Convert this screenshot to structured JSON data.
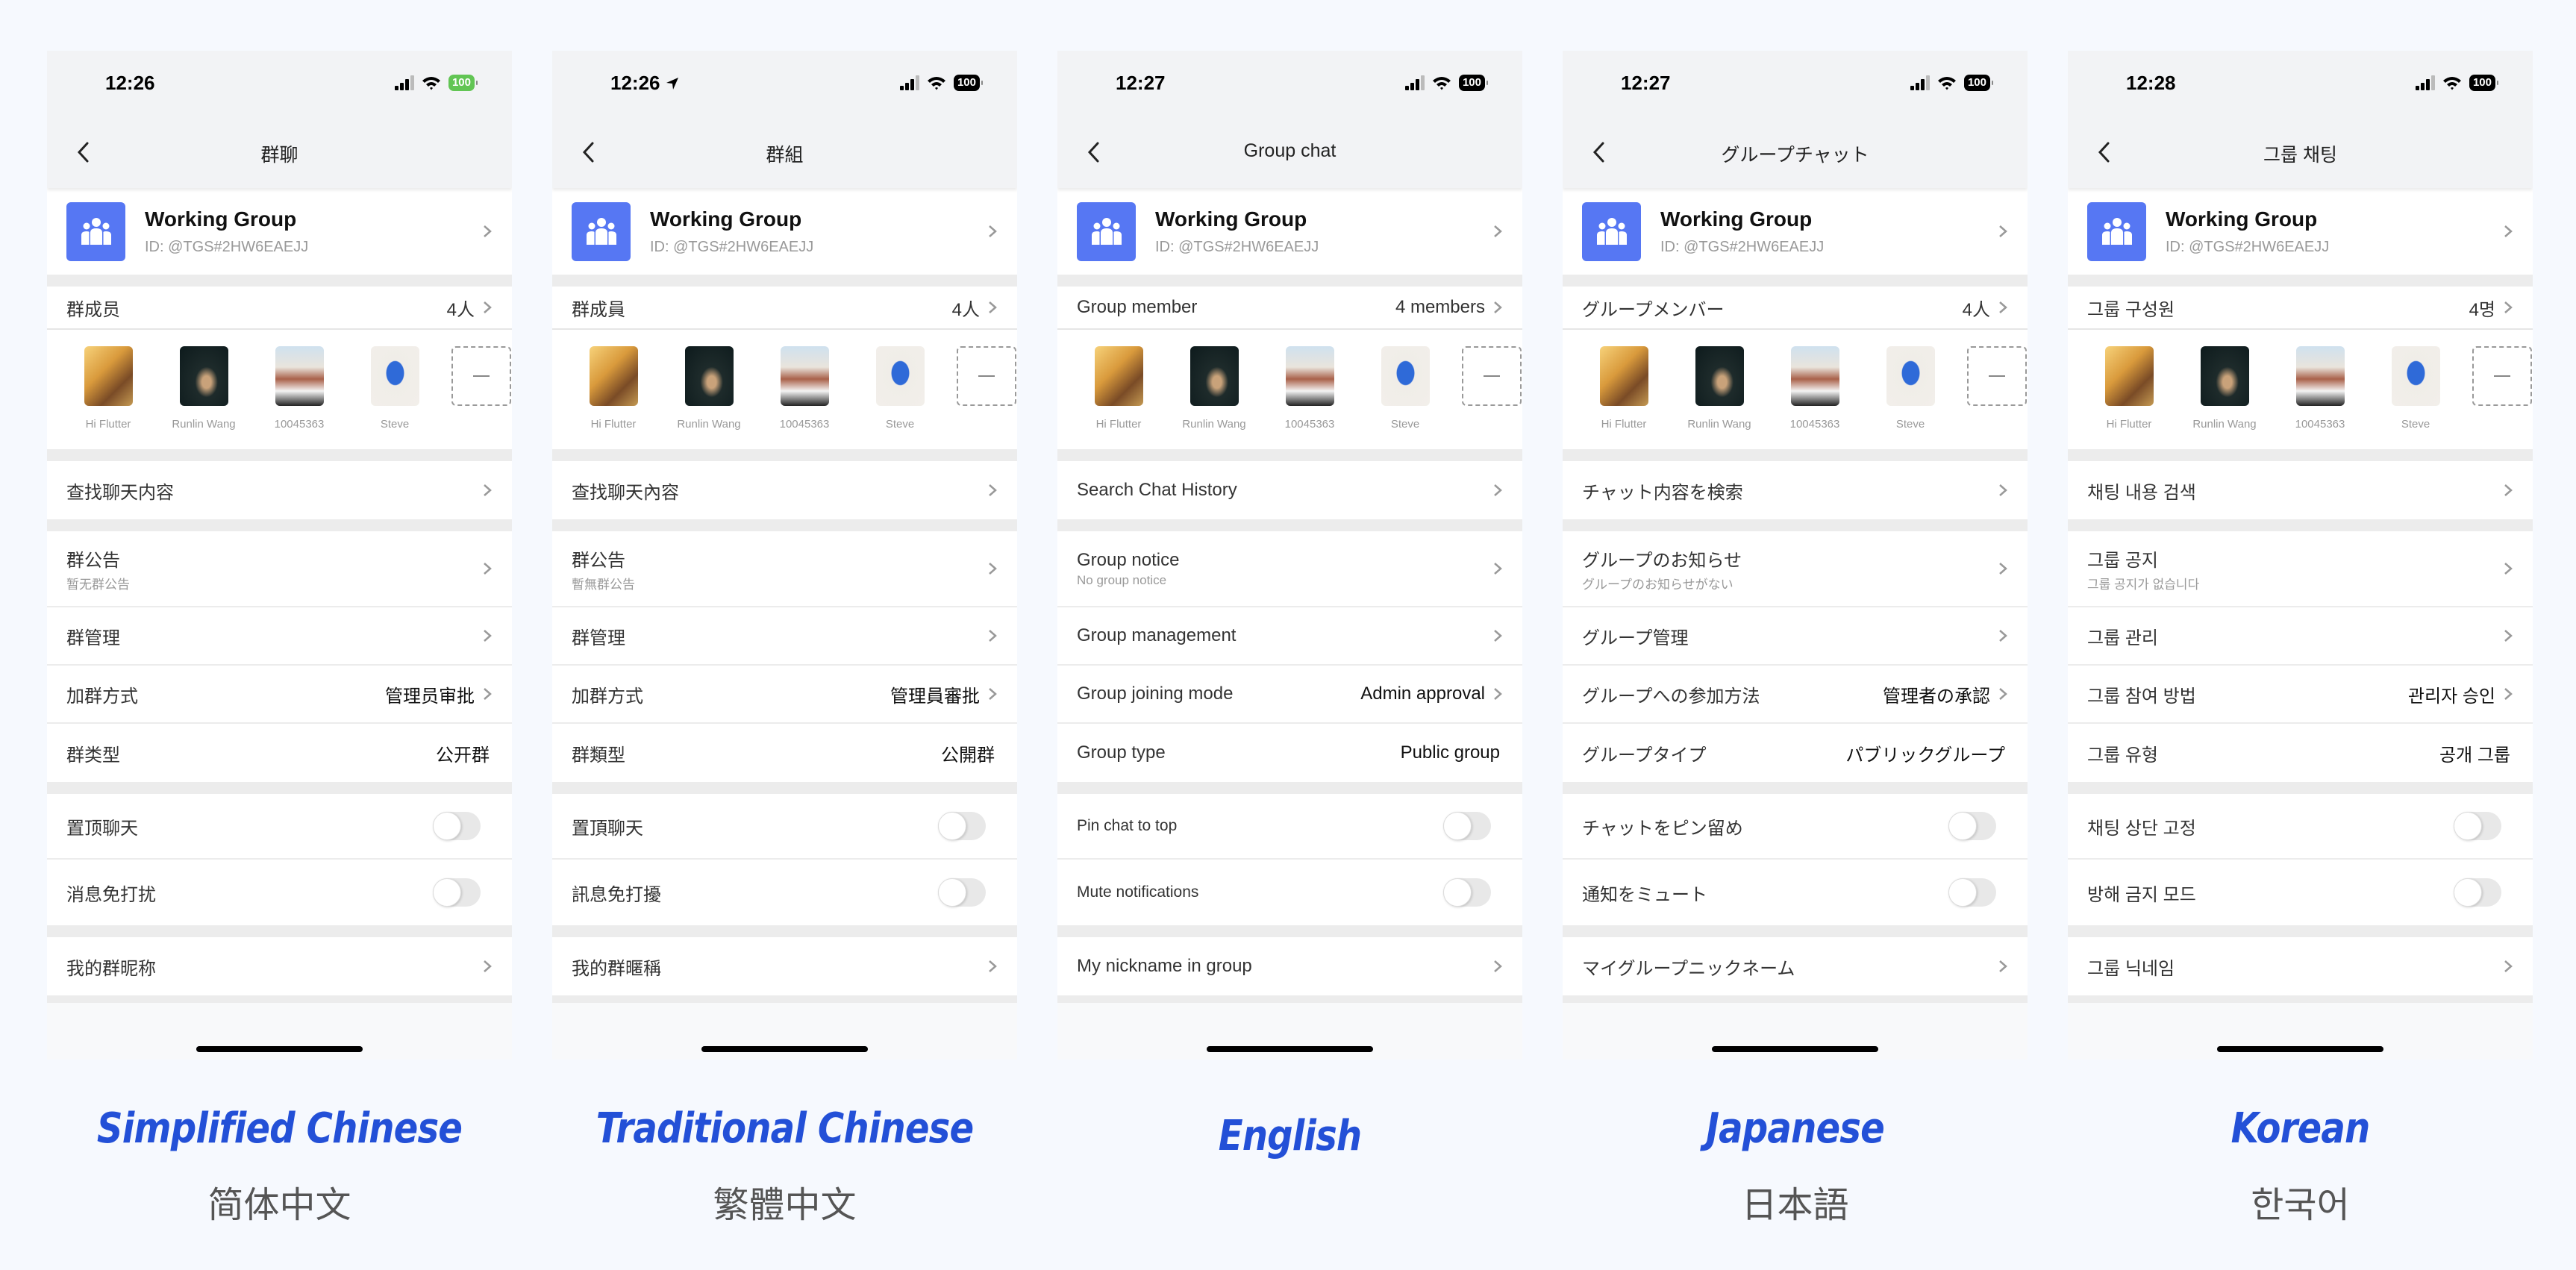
{
  "common": {
    "group_name": "Working Group",
    "group_id": "ID: @TGS#2HW6EAEJJ",
    "battery": "100",
    "members": [
      {
        "name": "Hi Flutter"
      },
      {
        "name": "Runlin Wang"
      },
      {
        "name": "10045363"
      },
      {
        "name": "Steve"
      }
    ],
    "toggles": {
      "pin_chat": false,
      "mute": false
    }
  },
  "panels": [
    {
      "time": "12:26",
      "title": "群聊",
      "members_label": "群成员",
      "members_count": "4人",
      "search": "查找聊天内容",
      "notice": "群公告",
      "notice_sub": "暂无群公告",
      "management": "群管理",
      "join_mode": "加群方式",
      "join_mode_value": "管理员审批",
      "group_type": "群类型",
      "group_type_value": "公开群",
      "pin": "置顶聊天",
      "mute": "消息免打扰",
      "nickname": "我的群昵称",
      "caption_en": "Simplified Chinese",
      "caption_native": "简体中文"
    },
    {
      "time": "12:26",
      "title": "群組",
      "members_label": "群成員",
      "members_count": "4人",
      "search": "查找聊天內容",
      "notice": "群公告",
      "notice_sub": "暫無群公告",
      "management": "群管理",
      "join_mode": "加群方式",
      "join_mode_value": "管理員審批",
      "group_type": "群類型",
      "group_type_value": "公開群",
      "pin": "置頂聊天",
      "mute": "訊息免打擾",
      "nickname": "我的群暱稱",
      "caption_en": "Traditional Chinese",
      "caption_native": "繁體中文"
    },
    {
      "time": "12:27",
      "title": "Group chat",
      "members_label": "Group member",
      "members_count": "4 members",
      "search": "Search Chat History",
      "notice": "Group notice",
      "notice_sub": "No group notice",
      "management": "Group management",
      "join_mode": "Group joining mode",
      "join_mode_value": "Admin approval",
      "group_type": "Group type",
      "group_type_value": "Public group",
      "pin": "Pin chat to top",
      "mute": "Mute notifications",
      "nickname": "My nickname in group",
      "caption_en": "English",
      "caption_native": ""
    },
    {
      "time": "12:27",
      "title": "グループチャット",
      "members_label": "グループメンバー",
      "members_count": "4人",
      "search": "チャット内容を検索",
      "notice": "グループのお知らせ",
      "notice_sub": "グループのお知らせがない",
      "management": "グループ管理",
      "join_mode": "グループへの参加方法",
      "join_mode_value": "管理者の承認",
      "group_type": "グループタイプ",
      "group_type_value": "パブリックグループ",
      "pin": "チャットをピン留め",
      "mute": "通知をミュート",
      "nickname": "マイグループニックネーム",
      "caption_en": "Japanese",
      "caption_native": "日本語"
    },
    {
      "time": "12:28",
      "title": "그룹 채팅",
      "members_label": "그룹 구성원",
      "members_count": "4명",
      "search": "채팅 내용 검색",
      "notice": "그룹 공지",
      "notice_sub": "그룹 공지가 없습니다",
      "management": "그룹 관리",
      "join_mode": "그룹 참여 방법",
      "join_mode_value": "관리자 승인",
      "group_type": "그룹 유형",
      "group_type_value": "공개 그룹",
      "pin": "채팅 상단 고정",
      "mute": "방해 금지 모드",
      "nickname": "그룹 닉네임",
      "caption_en": "Korean",
      "caption_native": "한국어"
    }
  ],
  "colors": {
    "accent": "#2350d7",
    "group_icon": "#5677f3",
    "battery_green": "#62c554"
  }
}
